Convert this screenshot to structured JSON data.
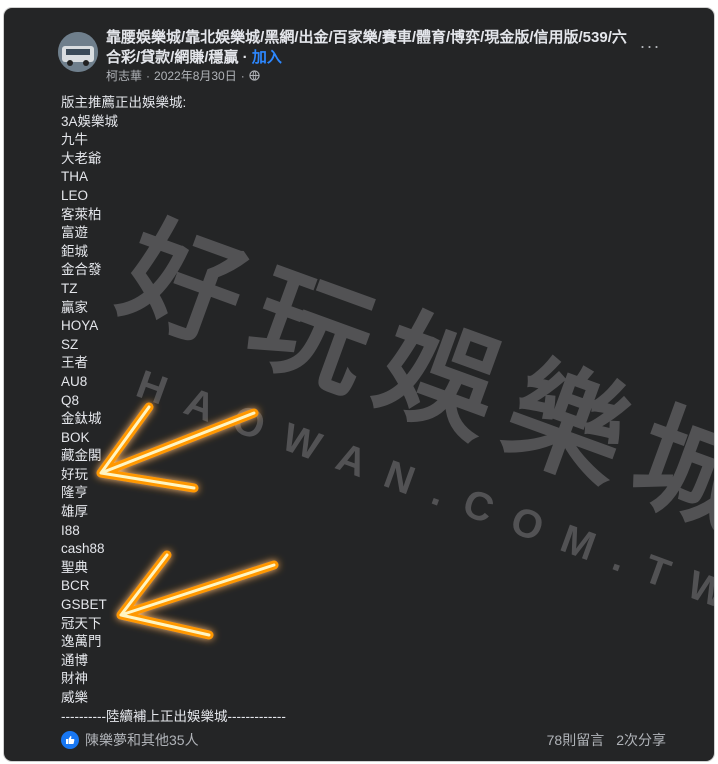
{
  "post": {
    "title": "靠腰娛樂城/靠北娛樂城/黑網/出金/百家樂/賽車/體育/博弈/現金版/信用版/539/六合彩/貸款/網賺/穩贏",
    "join_label": "加入",
    "author": "柯志華",
    "date": "2022年8月30日",
    "separator": "·",
    "more_label": "···",
    "heading": "版主推薦正出娛樂城:",
    "items": [
      "3A娛樂城",
      "九牛",
      "大老爺",
      "THA",
      "LEO",
      "客萊柏",
      "富遊",
      "鉅城",
      "金合發",
      "TZ",
      "贏家",
      "HOYA",
      "SZ",
      "王者",
      "AU8",
      "Q8",
      "金鈦城",
      "BOK",
      "藏金閣",
      "好玩",
      "隆亨",
      "雄厚",
      "I88",
      "cash88",
      "聖典",
      "BCR",
      "GSBET",
      "冠天下",
      "逸萬門",
      "通博",
      "財神",
      "威樂"
    ],
    "closing": "----------陸續補上正出娛樂城-------------",
    "reactions_text": "陳樂夢和其他35人",
    "comments_text": "78則留言",
    "shares_text": "2次分享"
  },
  "watermark": {
    "main_text": "好玩娛樂城",
    "sub_text": "HAOWAN.COM.TW"
  },
  "colors": {
    "card_bg": "#242526",
    "text_primary": "#e4e6eb",
    "text_secondary": "#b0b3b8",
    "link": "#2d88ff",
    "arrow_glow": "#ffb300",
    "like": "#1877f2"
  },
  "icons": [
    "group-avatar-icon",
    "globe-icon",
    "more-options-icon",
    "like-icon",
    "arrow-icon"
  ]
}
